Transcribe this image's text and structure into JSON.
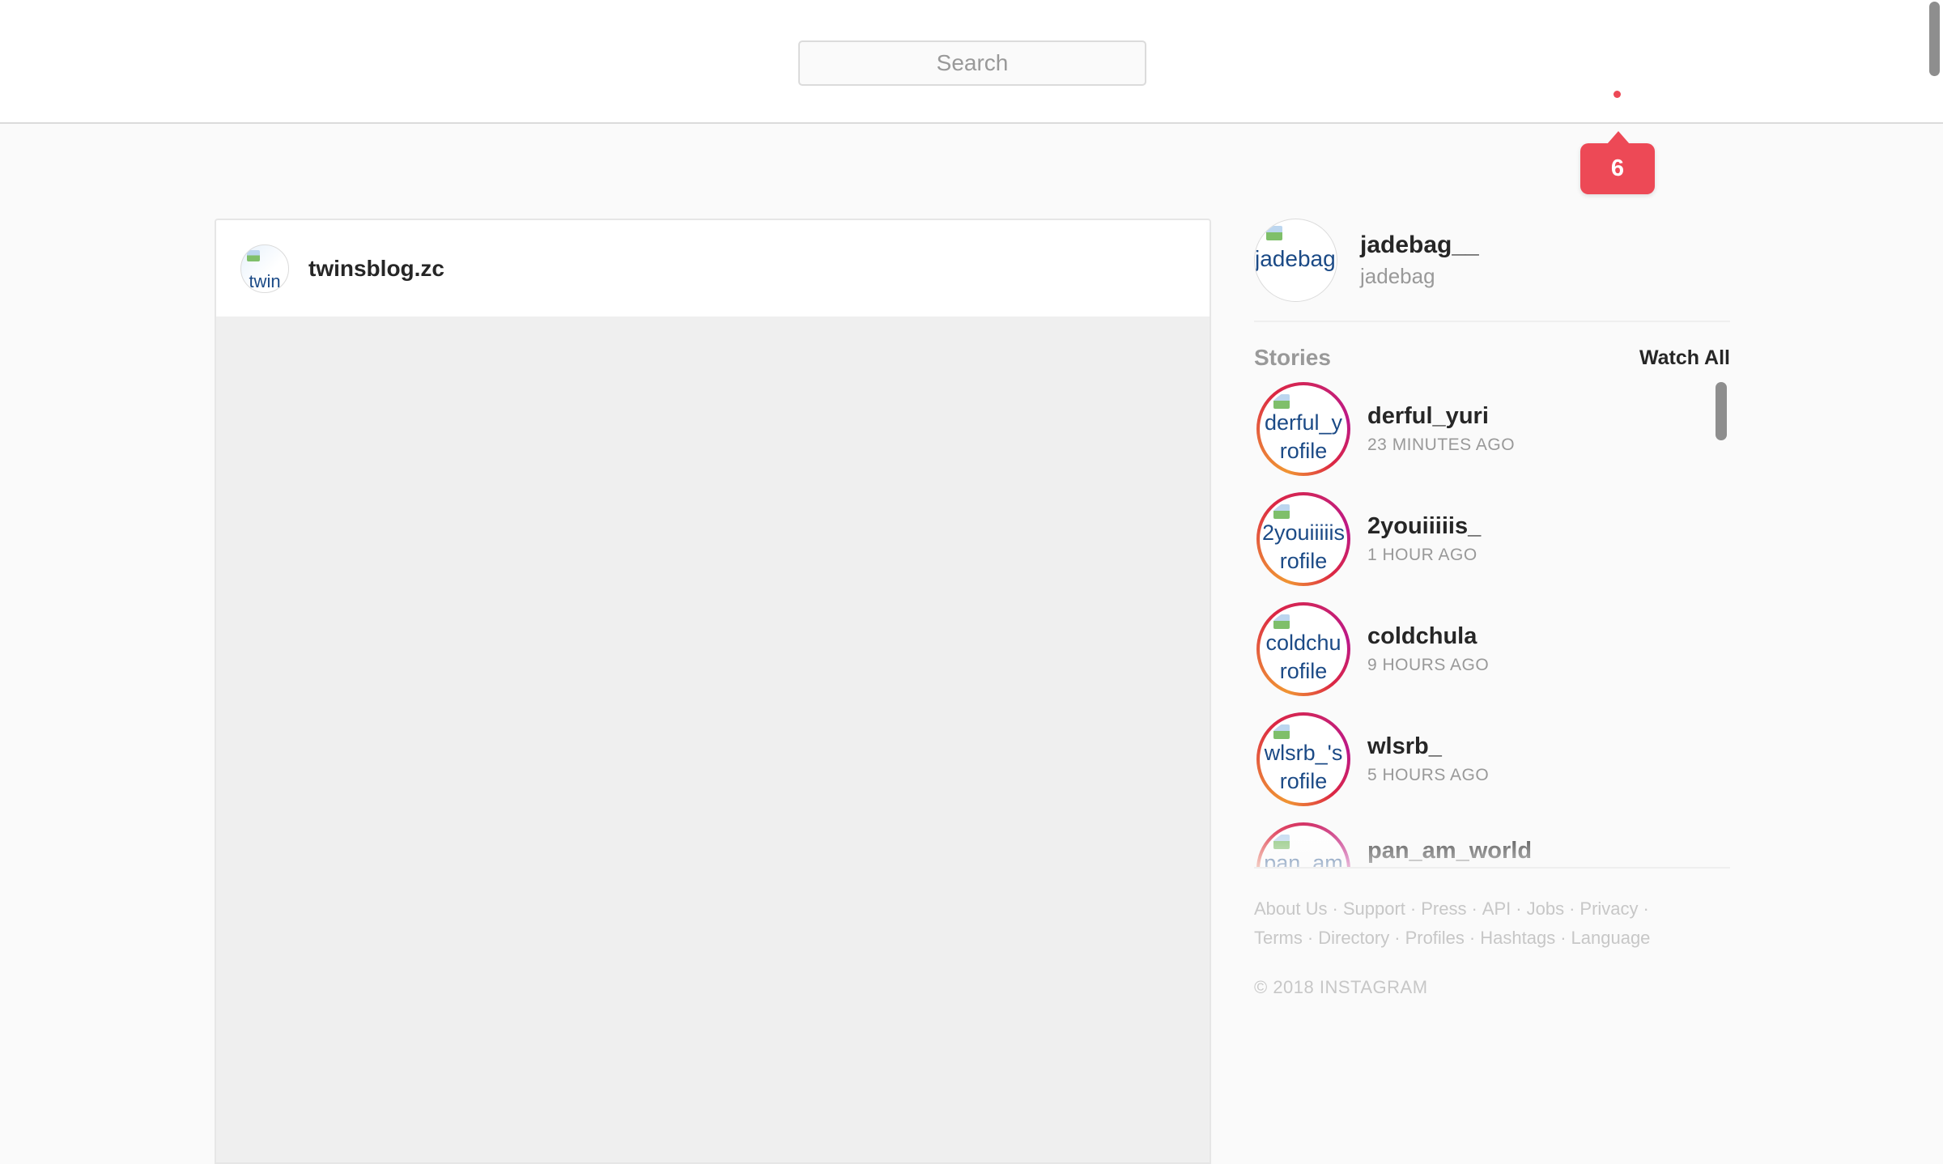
{
  "search": {
    "placeholder": "Search"
  },
  "notification": {
    "count": "6",
    "color": "#ed4956"
  },
  "post": {
    "username": "twinsblog.zc",
    "avatar_alt": "twin"
  },
  "profile": {
    "username": "jadebag__",
    "fullname": "jadebag",
    "avatar_alt": "jadebag rofile"
  },
  "stories": {
    "title": "Stories",
    "watch_all": "Watch All",
    "items": [
      {
        "name": "derful_yuri",
        "time": "23 MINUTES AGO",
        "alt_top": "derful_y",
        "alt_bottom": "rofile"
      },
      {
        "name": "2youiiiiis_",
        "time": "1 HOUR AGO",
        "alt_top": "2youiiiiis",
        "alt_bottom": "rofile"
      },
      {
        "name": "coldchula",
        "time": "9 HOURS AGO",
        "alt_top": "coldchu",
        "alt_bottom": "rofile"
      },
      {
        "name": "wlsrb_",
        "time": "5 HOURS AGO",
        "alt_top": "wlsrb_'s",
        "alt_bottom": "rofile"
      },
      {
        "name": "pan_am_world",
        "time": "",
        "alt_top": "pan_am",
        "alt_bottom": ""
      }
    ]
  },
  "footer": {
    "links": [
      "About Us",
      "Support",
      "Press",
      "API",
      "Jobs",
      "Privacy",
      "Terms",
      "Directory",
      "Profiles",
      "Hashtags",
      "Language"
    ],
    "copyright": "© 2018 INSTAGRAM"
  },
  "colors": {
    "accent": "#ed4956",
    "story_ring_start": "#f09433",
    "story_ring_end": "#bc1888",
    "muted_text": "#999999"
  }
}
